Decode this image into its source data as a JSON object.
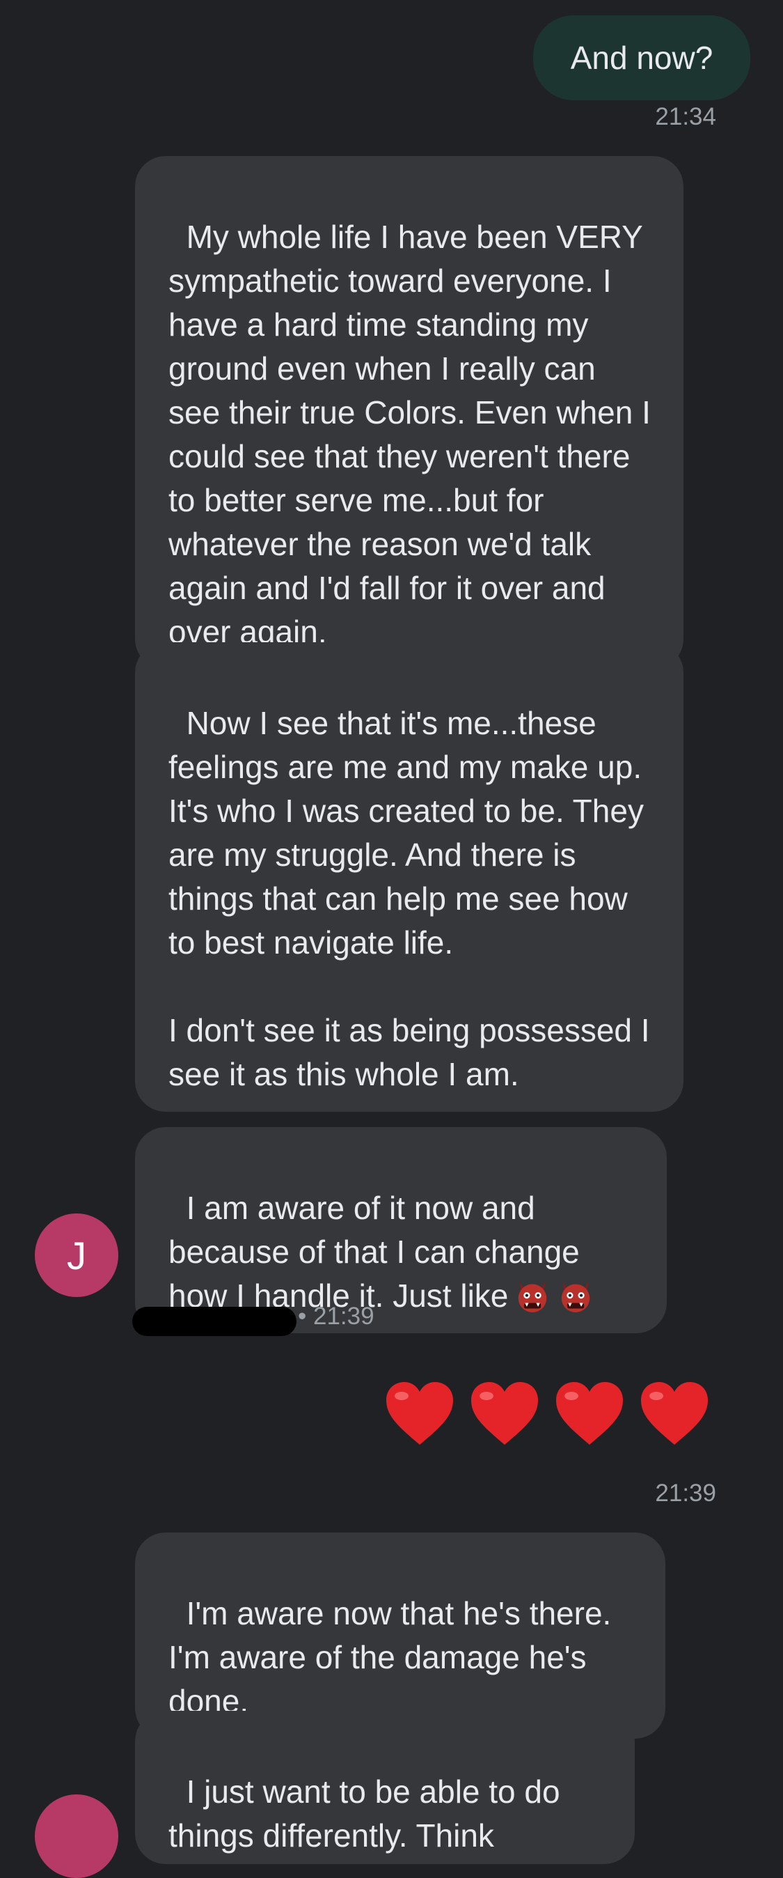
{
  "conversation": {
    "sent_1": {
      "text": "And now?",
      "time": "21:34"
    },
    "received_1": "My whole life I have been VERY sympathetic toward everyone. I have a hard time standing my ground even when I really can see their true Colors. Even when I could see that they weren't there to better serve me...but for whatever the reason we'd talk again and I'd fall for it over and over again.",
    "received_2": "Now I see that it's me...these feelings are me and my make up. It's who I was created to be. They are my struggle. And there is things that can help me see how to best navigate life.\n\nI don't see it as being possessed I see it as this whole I am.",
    "received_3": "I am aware of it now and because of that I can change how I handle it. Just like",
    "received_3_emoji": [
      "ogre-emoji",
      "ogre-emoji"
    ],
    "sender_meta": "• 21:39",
    "avatar_initial": "J",
    "sent_2": {
      "emoji": [
        "red-heart-emoji",
        "red-heart-emoji",
        "red-heart-emoji",
        "red-heart-emoji"
      ],
      "time": "21:39"
    },
    "received_4": "I'm aware now that he's there.\nI'm aware of the damage he's done.",
    "received_5": "I just want to be able to do things differently. Think"
  },
  "colors": {
    "background": "#202124",
    "sent_bubble": "#1c3530",
    "received_bubble": "#35373b",
    "avatar": "#b73a66",
    "timestamp": "#9aa0a6"
  }
}
